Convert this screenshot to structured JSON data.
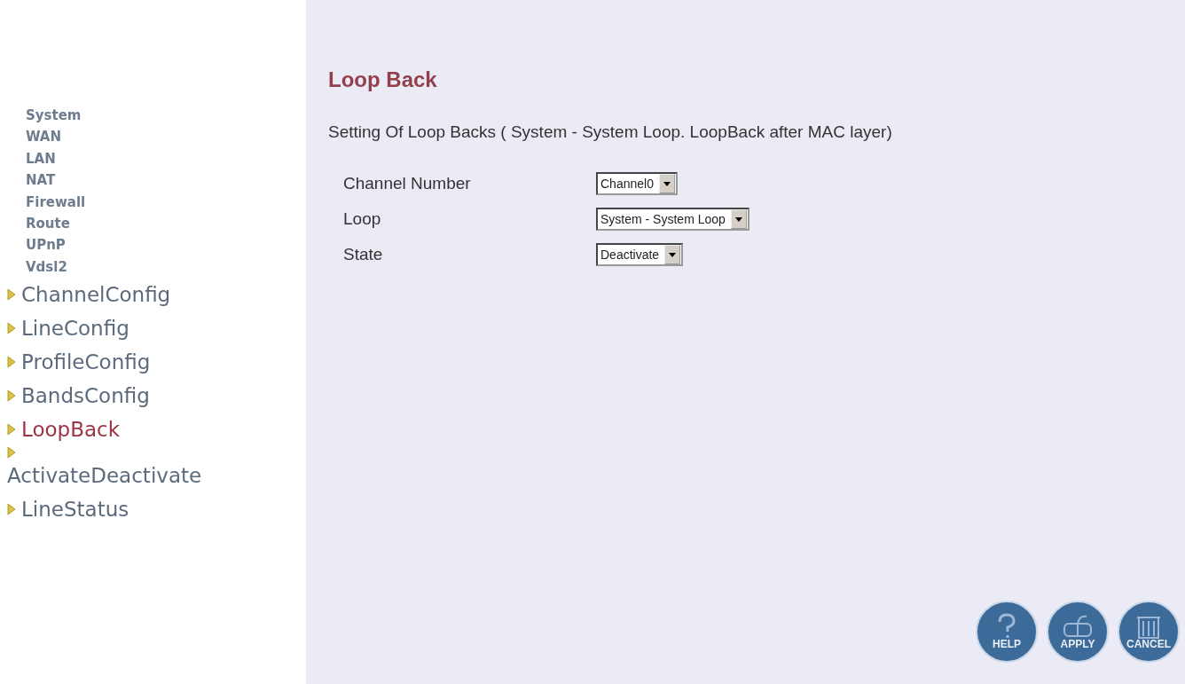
{
  "sidebar": {
    "items": [
      {
        "label": "System",
        "kind": "plain",
        "selected": false
      },
      {
        "label": "WAN",
        "kind": "plain",
        "selected": false
      },
      {
        "label": "LAN",
        "kind": "plain",
        "selected": false
      },
      {
        "label": "NAT",
        "kind": "plain",
        "selected": false
      },
      {
        "label": "Firewall",
        "kind": "plain",
        "selected": false
      },
      {
        "label": "Route",
        "kind": "plain",
        "selected": false
      },
      {
        "label": "UPnP",
        "kind": "plain",
        "selected": false
      },
      {
        "label": "Vdsl2",
        "kind": "plain",
        "selected": false
      },
      {
        "label": "ChannelConfig",
        "kind": "arrow",
        "selected": false
      },
      {
        "label": "LineConfig",
        "kind": "arrow",
        "selected": false
      },
      {
        "label": "ProfileConfig",
        "kind": "arrow",
        "selected": false
      },
      {
        "label": "BandsConfig",
        "kind": "arrow",
        "selected": false
      },
      {
        "label": "LoopBack",
        "kind": "arrow",
        "selected": true
      },
      {
        "label": "ActivateDeactivate",
        "kind": "arrow",
        "selected": false
      },
      {
        "label": "LineStatus",
        "kind": "arrow",
        "selected": false
      }
    ]
  },
  "page": {
    "title": "Loop Back",
    "description": "Setting Of Loop Backs ( System - System Loop. LoopBack after MAC layer)",
    "fields": [
      {
        "label": "Channel Number",
        "value": "Channel0"
      },
      {
        "label": "Loop",
        "value": "System - System Loop"
      },
      {
        "label": "State",
        "value": "Deactivate"
      }
    ]
  },
  "buttons": [
    {
      "label": "HELP",
      "kind": "help"
    },
    {
      "label": "APPLY",
      "kind": "apply"
    },
    {
      "label": "CANCEL",
      "kind": "cancel"
    }
  ]
}
